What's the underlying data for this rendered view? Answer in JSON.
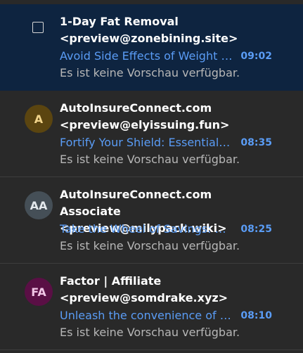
{
  "messages": [
    {
      "sender_name": "1-Day Fat Removal",
      "sender_address": "<preview@zonebining.site>",
      "subject": "Avoid Side Effects of Weight Loss Drugs",
      "time": "09:02",
      "preview": "Es ist keine Vorschau verfügbar.",
      "selected": true,
      "avatar_initials": "",
      "avatar_bg": "",
      "avatar_fg": ""
    },
    {
      "sender_name": "AutoInsureConnect.com",
      "sender_address": "<preview@elyissuing.fun>",
      "subject": "Fortify Your Shield: Essential Coverage",
      "time": "08:35",
      "preview": "Es ist keine Vorschau verfügbar.",
      "selected": false,
      "avatar_initials": "A",
      "avatar_bg": "#5b4510",
      "avatar_fg": "#f1d48a"
    },
    {
      "sender_name": "AutoInsureConnect.com Associate",
      "sender_address": "<preview@milypack.wiki>",
      "subject": "Take the Wheel of Savings: Compare Rates",
      "time": "08:25",
      "preview": "Es ist keine Vorschau verfügbar.",
      "selected": false,
      "avatar_initials": "AA",
      "avatar_bg": "#454f57",
      "avatar_fg": "#e3e8ec"
    },
    {
      "sender_name": "Factor | Affiliate",
      "sender_address": "<preview@somdrake.xyz>",
      "subject": "Unleash the convenience of fresh meals",
      "time": "08:10",
      "preview": "Es ist keine Vorschau verfügbar.",
      "selected": false,
      "avatar_initials": "FA",
      "avatar_bg": "#5a0f45",
      "avatar_fg": "#f1c5e6"
    }
  ]
}
